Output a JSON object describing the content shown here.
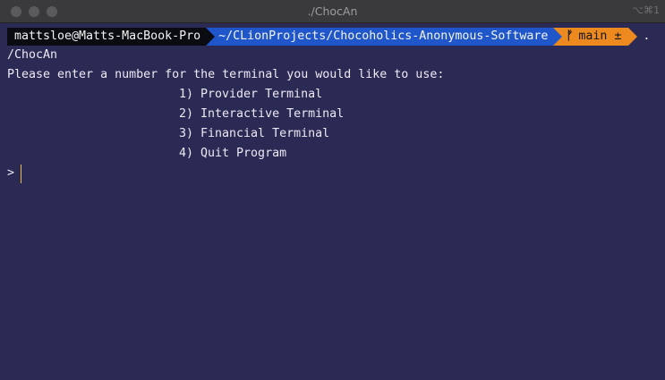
{
  "window": {
    "title": "./ChocAn",
    "shortcut": "⌥⌘1"
  },
  "prompt": {
    "user_host": "mattsloe@Matts-MacBook-Pro",
    "path": "~/CLionProjects/Chocoholics-Anonymous-Software",
    "branch_icon": "ᚠ",
    "branch": "main ±",
    "tail": "."
  },
  "output": {
    "cwd_line": "/ChocAn",
    "instruction": "Please enter a number for the terminal you would like to use:",
    "options": [
      "1) Provider Terminal",
      "2) Interactive Terminal",
      "3) Financial Terminal",
      "4) Quit Program"
    ],
    "input_prompt": ">"
  },
  "colors": {
    "background": "#2b2a55",
    "user_segment": "#0b0c12",
    "path_segment": "#1f56c9",
    "git_segment": "#ec8a1f",
    "cursor": "#f0b84a"
  },
  "icons": {
    "branch": "git-branch-icon"
  }
}
